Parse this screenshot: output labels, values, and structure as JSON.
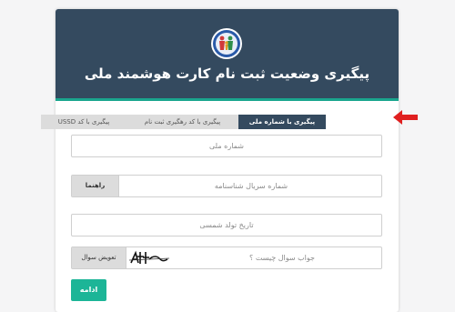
{
  "header": {
    "title": "پیگیری وضعیت ثبت نام کارت هوشمند ملی"
  },
  "tabs": [
    {
      "label": "پیگیری با کد USSD",
      "active": false
    },
    {
      "label": "پیگیری با کد رهگیری ثبت نام",
      "active": false
    },
    {
      "label": "پیگیری با شماره ملی",
      "active": true
    }
  ],
  "form": {
    "national_id_placeholder": "شماره ملی",
    "birth_cert_serial_placeholder": "شماره سریال شناسنامه",
    "help_label": "راهنما",
    "birth_date_placeholder": "تاریخ تولد شمسی",
    "captcha_refresh_label": "تعویض سوال",
    "captcha_answer_placeholder": "جواب سوال چیست ؟",
    "submit_label": "ادامه"
  },
  "colors": {
    "header_bg": "#344a5f",
    "accent": "#1aa68e",
    "button": "#1cb597",
    "arrow": "#e02020"
  }
}
